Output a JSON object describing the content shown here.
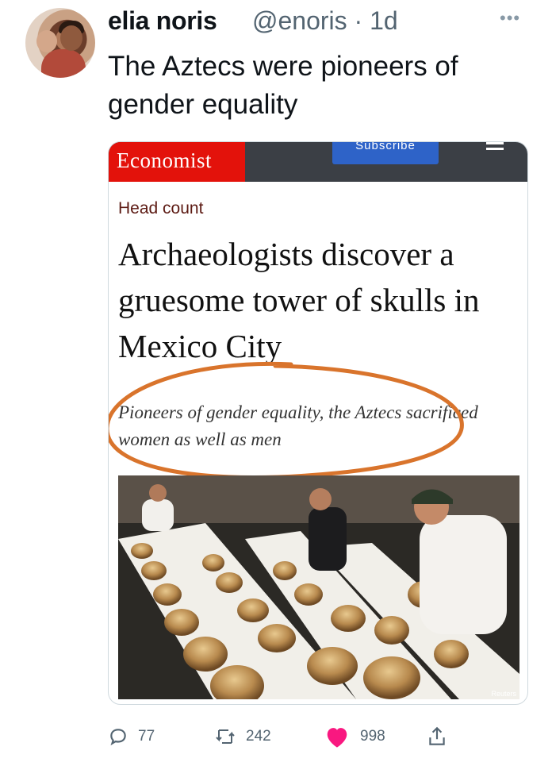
{
  "tweet": {
    "author_name": "elia noris",
    "handle_time": "@enoris · 1d",
    "more_icon": "more-dots-icon",
    "text": "The Aztecs were pioneers of gender equality"
  },
  "card": {
    "brand": "Economist",
    "subscribe_label": "Subscribe",
    "rubric": "Head count",
    "headline": "Archaeologists discover a gruesome tower of skulls in Mexico City",
    "subheadline": "Pioneers of gender equality, the Aztecs sacrificed women as well as men",
    "photo_credit": "Reuters",
    "brand_color": "#e3120b",
    "annotation_color": "#d9742c"
  },
  "actions": {
    "replies": "77",
    "retweets": "242",
    "likes": "998",
    "like_color": "#f91880"
  }
}
